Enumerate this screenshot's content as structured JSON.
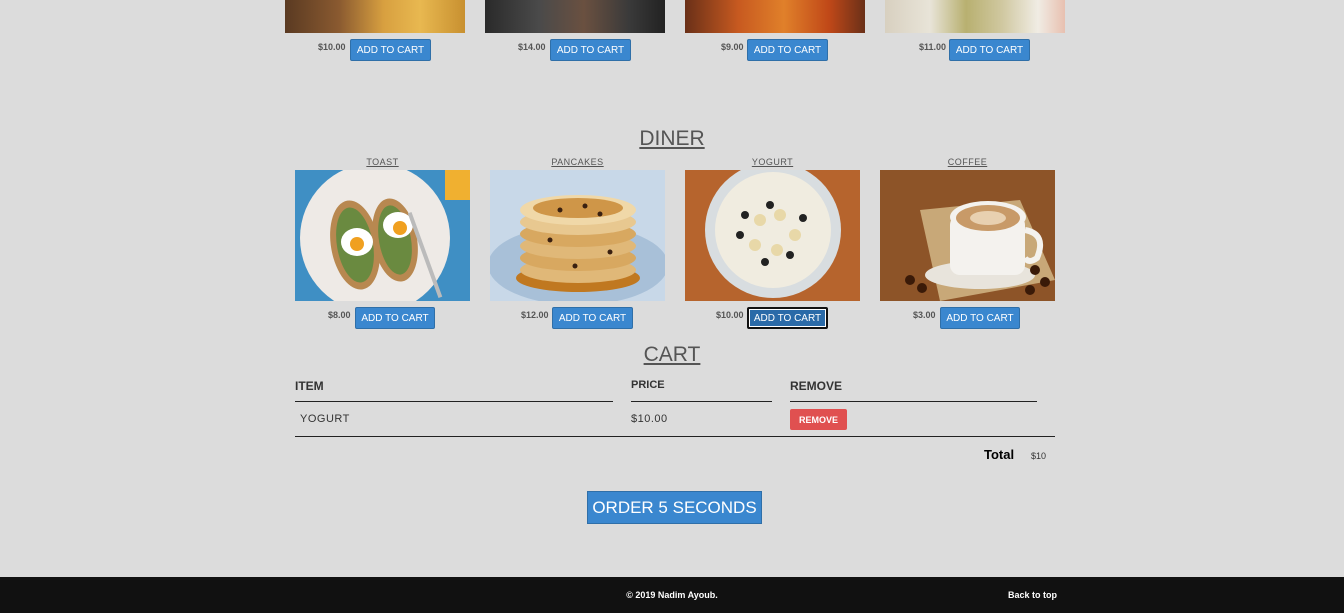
{
  "top_row": {
    "items": [
      {
        "price": "$10.00",
        "button": "ADD TO CART"
      },
      {
        "price": "$14.00",
        "button": "ADD TO CART"
      },
      {
        "price": "$9.00",
        "button": "ADD TO CART"
      },
      {
        "price": "$11.00",
        "button": "ADD TO CART"
      }
    ]
  },
  "diner": {
    "title": "DINER",
    "items": [
      {
        "name": "TOAST",
        "price": "$8.00",
        "button": "ADD TO CART"
      },
      {
        "name": "PANCAKES",
        "price": "$12.00",
        "button": "ADD TO CART"
      },
      {
        "name": "YOGURT",
        "price": "$10.00",
        "button": "ADD TO CART"
      },
      {
        "name": "COFFEE",
        "price": "$3.00",
        "button": "ADD TO CART"
      }
    ]
  },
  "cart": {
    "title": "CART",
    "headers": {
      "item": "ITEM",
      "price": "PRICE",
      "remove": "REMOVE"
    },
    "rows": [
      {
        "item": "YOGURT",
        "price": "$10.00",
        "remove": "REMOVE"
      }
    ],
    "total_label": "Total",
    "total_value": "$10"
  },
  "order_button": "ORDER 5 SECONDS",
  "footer": {
    "copyright": "© 2019 Nadim Ayoub.",
    "back_to_top": "Back to top"
  },
  "colors": {
    "accent": "#3a87cf",
    "danger": "#e05050",
    "background": "#dcdcdc",
    "footer": "#111111"
  }
}
